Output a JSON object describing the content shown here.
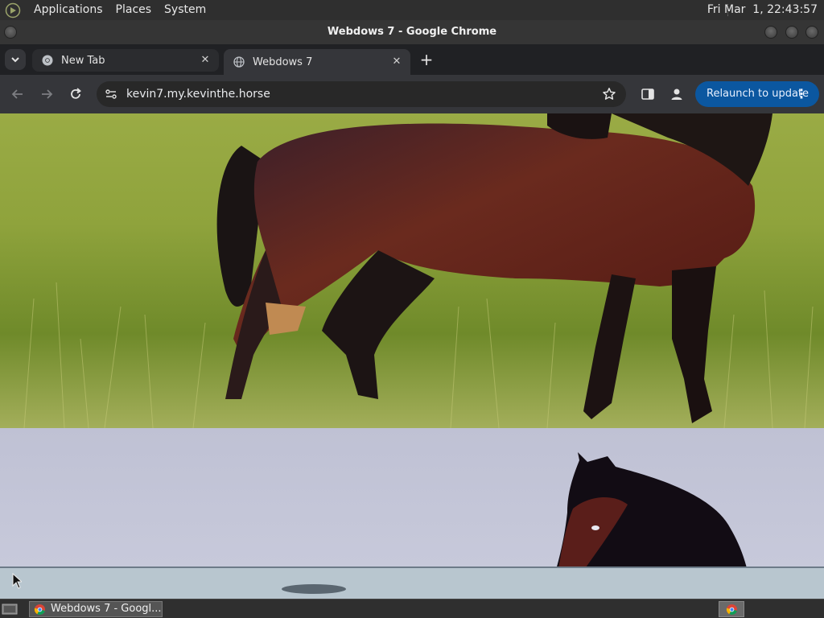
{
  "panel": {
    "menus": [
      "Applications",
      "Places",
      "System"
    ],
    "clock": "Fri Mar  1, 22:43:57"
  },
  "window": {
    "title": "Webdows 7 - Google Chrome"
  },
  "browser": {
    "tabs": [
      {
        "label": "New Tab",
        "active": false
      },
      {
        "label": "Webdows 7",
        "active": true
      }
    ],
    "url": "kevin7.my.kevinthe.horse",
    "relaunch_label": "Relaunch to update"
  },
  "taskbar": {
    "task_label": "Webdows 7 - Googl..."
  },
  "colors": {
    "accent": "#0b57a0",
    "panel": "#2f2f2f",
    "toolbar": "#35363a",
    "tabstrip": "#202124"
  }
}
